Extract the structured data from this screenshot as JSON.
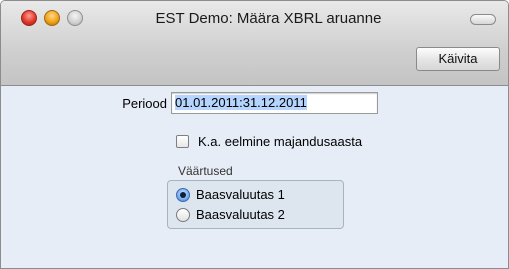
{
  "window": {
    "title": "EST Demo: Määra XBRL aruanne",
    "run_button_label": "Käivita"
  },
  "form": {
    "period_label": "Periood",
    "period_value": "01.01.2011:31.12.2011",
    "include_previous_year_label": "K.a. eelmine majandusaasta",
    "include_previous_year_checked": false,
    "values_group_title": "Väärtused",
    "values_options": [
      "Baasvaluutas 1",
      "Baasvaluutas 2"
    ],
    "values_selected": "Baasvaluutas 1"
  }
}
